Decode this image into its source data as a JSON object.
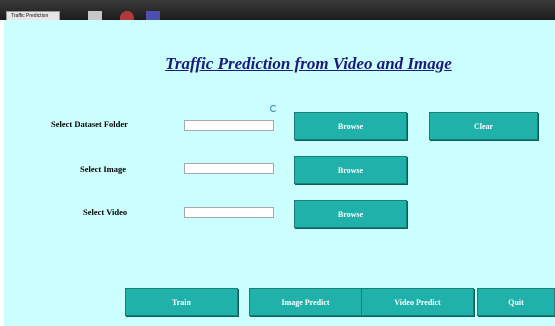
{
  "window": {
    "title": "Traffic Prediction"
  },
  "heading": "Traffic Prediction from Video and Image",
  "form": {
    "dataset": {
      "label": "Select Dataset Folder",
      "value": ""
    },
    "image": {
      "label": "Select Image",
      "value": ""
    },
    "video": {
      "label": "Select Video",
      "value": ""
    }
  },
  "buttons": {
    "browse_dataset": "Browse",
    "clear": "Clear",
    "browse_image": "Browse",
    "browse_video": "Browse",
    "train": "Train",
    "image_predict": "Image Predict",
    "video_predict": "Video Predict",
    "quit": "Quit"
  },
  "colors": {
    "background": "#ccffff",
    "button": "#20b2aa",
    "heading": "#1a1a78"
  },
  "icons": {
    "loading": "spinner-icon"
  }
}
